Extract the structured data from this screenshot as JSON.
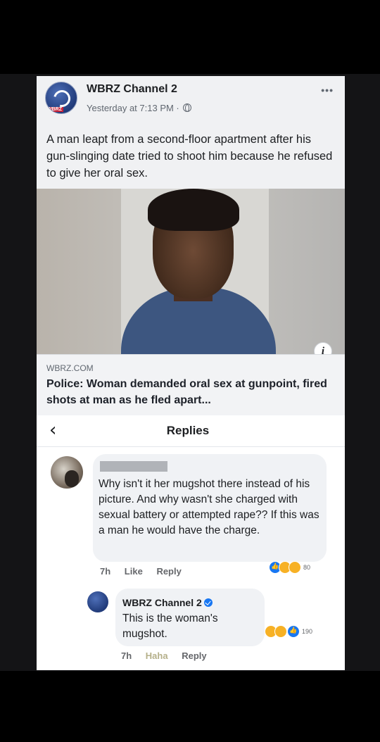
{
  "post": {
    "page_name": "WBRZ Channel 2",
    "avatar_tag": "WBRZ",
    "timestamp": "Yesterday at 7:13 PM ·",
    "more": "•••",
    "text": "A man leapt from a second-floor apartment after his gun-slinging date tried to shoot him because he refused to give her oral sex.",
    "info": "i",
    "link_domain": "WBRZ.COM",
    "link_title": "Police: Woman demanded oral sex at gunpoint, fired shots at man as he fled apart..."
  },
  "replies": {
    "back": "‹",
    "title": "Replies",
    "comment": {
      "text": "Why isn't it her mugshot there instead of his picture. And why wasn't she charged with sexual battery or attempted rape?? If this was a man he would have the charge.",
      "time": "7h",
      "like": "Like",
      "reply": "Reply",
      "reaction_count": "80"
    },
    "page_reply": {
      "name": "WBRZ Channel 2",
      "text": "This is the woman's mugshot.",
      "time": "7h",
      "haha": "Haha",
      "reply": "Reply",
      "reaction_count": "190"
    }
  }
}
